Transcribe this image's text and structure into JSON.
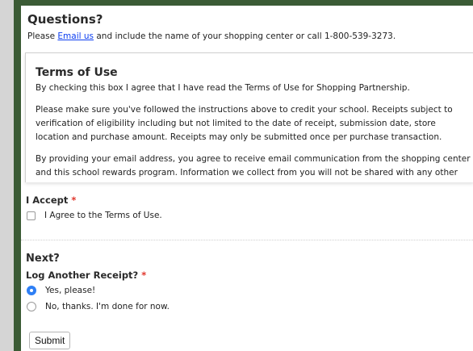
{
  "questions": {
    "title": "Questions?",
    "text_before": "Please ",
    "link_text": "Email us",
    "text_after": " and include the name of your shopping center or call 1-800-539-3273."
  },
  "terms": {
    "title": "Terms of Use",
    "p1": "By checking this box I agree that I have read the Terms of Use for Shopping Partnership.",
    "p2": "Please make sure you've followed the instructions above to credit your school. Receipts subject to verification of eligibility including but not limited to the date of receipt, submission date, store location and purchase amount. Receipts may only be submitted once per purchase transaction.",
    "p3": "By providing your email address, you agree to receive email communication from the shopping center and this school rewards program. Information we collect from you will not be shared with any other"
  },
  "accept": {
    "label": "I Accept",
    "required_mark": "*",
    "checkbox_label": "I Agree to the Terms of Use."
  },
  "next": {
    "title": "Next?",
    "question": "Log Another Receipt?",
    "required_mark": "*",
    "options": [
      {
        "label": "Yes, please!",
        "selected": true
      },
      {
        "label": "No, thanks. I'm done for now.",
        "selected": false
      }
    ]
  },
  "submit_label": "Submit",
  "colors": {
    "frame": "#3b5b35",
    "link": "#0b3df0",
    "required": "#e0352b",
    "radio_selected": "#2f7ff5"
  }
}
